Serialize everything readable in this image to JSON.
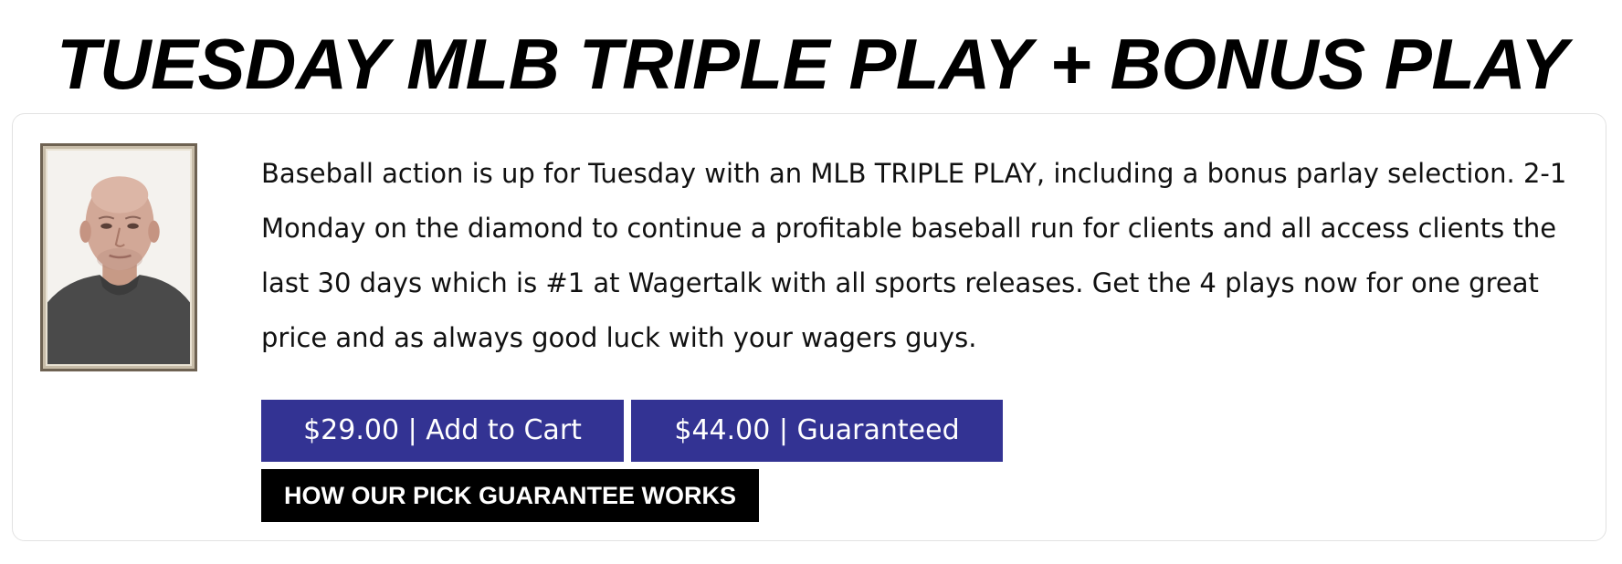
{
  "post": {
    "title": "TUESDAY MLB TRIPLE PLAY + BONUS PLAY",
    "description": "Baseball action is up for Tuesday with an MLB TRIPLE PLAY, including a bonus parlay selection. 2-1 Monday on the diamond to continue a profitable baseball run for clients and all access clients the last 30 days which is #1 at Wagertalk with all sports releases. Get the 4 plays now for one great price and as always good luck with your wagers guys."
  },
  "buttons": {
    "add_to_cart": "$29.00 | Add to Cart",
    "guaranteed": "$44.00 | Guaranteed",
    "guarantee_info": "HOW OUR PICK GUARANTEE WORKS"
  },
  "colors": {
    "button_primary": "#333393",
    "button_secondary": "#000000",
    "text": "#111111"
  },
  "icons": {
    "handicapper_photo": "handicapper-photo"
  }
}
